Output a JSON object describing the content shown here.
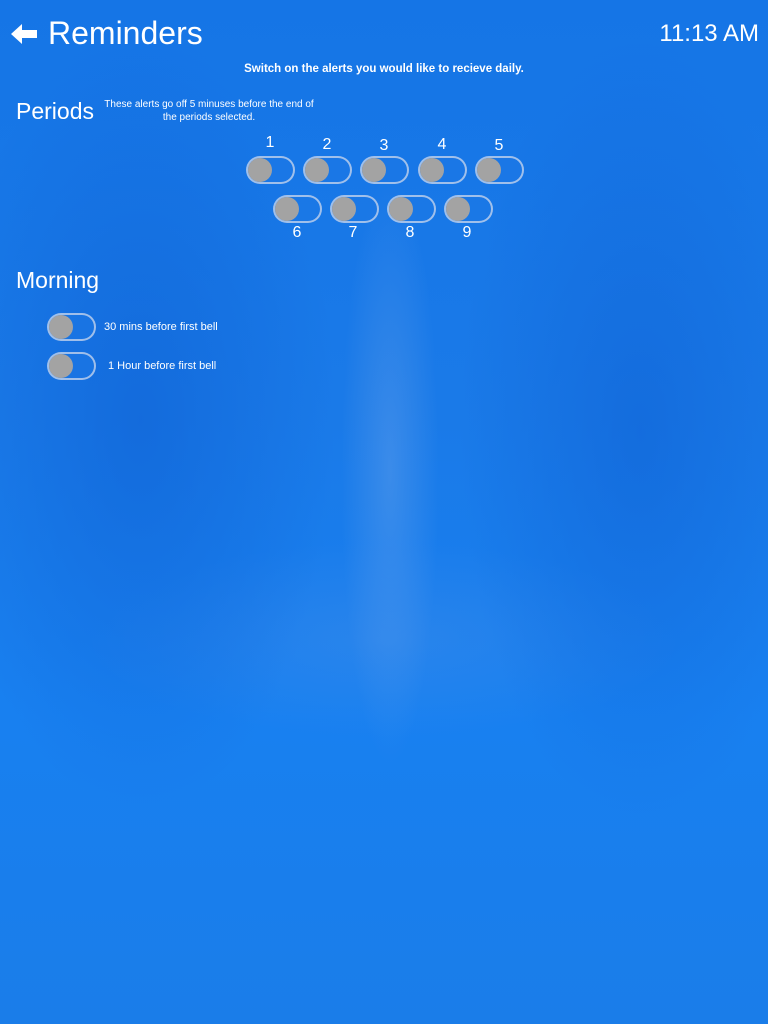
{
  "header": {
    "title": "Reminders",
    "time": "11:13 AM",
    "back_icon": "arrow-left-icon"
  },
  "instructions": "Switch on the alerts you would like to recieve daily.",
  "periods": {
    "heading": "Periods",
    "note": "These alerts go off 5 minuses before the end of the periods selected.",
    "items": [
      {
        "label": "1",
        "on": false
      },
      {
        "label": "2",
        "on": false
      },
      {
        "label": "3",
        "on": false
      },
      {
        "label": "4",
        "on": false
      },
      {
        "label": "5",
        "on": false
      },
      {
        "label": "6",
        "on": false
      },
      {
        "label": "7",
        "on": false
      },
      {
        "label": "8",
        "on": false
      },
      {
        "label": "9",
        "on": false
      }
    ]
  },
  "morning": {
    "heading": "Morning",
    "items": [
      {
        "label": "30 mins before first bell",
        "on": false
      },
      {
        "label": "1 Hour before first bell",
        "on": false
      }
    ]
  },
  "colors": {
    "background": "#1a7be8",
    "text": "#ffffff",
    "toggle_knob_off": "#a3a3a3"
  }
}
